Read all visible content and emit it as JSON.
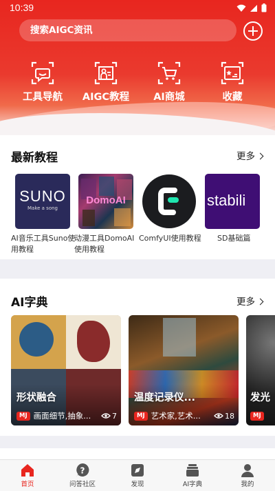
{
  "status_bar": {
    "time": "10:39"
  },
  "search": {
    "placeholder": "搜索AIGC资讯"
  },
  "quick_nav": [
    {
      "label": "工具导航",
      "icon": "chat-bubble-icon"
    },
    {
      "label": "AIGC教程",
      "icon": "tutorial-person-icon"
    },
    {
      "label": "AI商城",
      "icon": "shopping-cart-icon"
    },
    {
      "label": "收藏",
      "icon": "favorite-image-icon"
    }
  ],
  "tutorials": {
    "title": "最新教程",
    "more": "更多",
    "items": [
      {
        "label": "AI音乐工具Suno使用教程",
        "thumb_text": "SUNO",
        "thumb_subtext": "Make a song"
      },
      {
        "label": "动漫工具DomoAI使用教程",
        "thumb_text": "DomoAI"
      },
      {
        "label": "ComfyUI使用教程"
      },
      {
        "label": "SD基础篇",
        "thumb_text": "stabili"
      }
    ]
  },
  "dictionary": {
    "title": "AI字典",
    "more": "更多",
    "items": [
      {
        "title": "形状融合",
        "badge": "MJ",
        "tags": "画面细节,抽象...",
        "views": "7"
      },
      {
        "title": "温度记录仪...",
        "badge": "MJ",
        "tags": "艺术家,艺术...",
        "views": "18"
      },
      {
        "title": "发光",
        "badge": "MJ"
      }
    ]
  },
  "bottom_nav": [
    {
      "label": "首页",
      "icon": "home-icon",
      "active": true
    },
    {
      "label": "问答社区",
      "icon": "question-icon"
    },
    {
      "label": "发现",
      "icon": "discover-icon"
    },
    {
      "label": "AI字典",
      "icon": "dictionary-icon"
    },
    {
      "label": "我的",
      "icon": "profile-icon"
    }
  ],
  "colors": {
    "brand_red": "#e8261f",
    "background": "#efeff4"
  }
}
